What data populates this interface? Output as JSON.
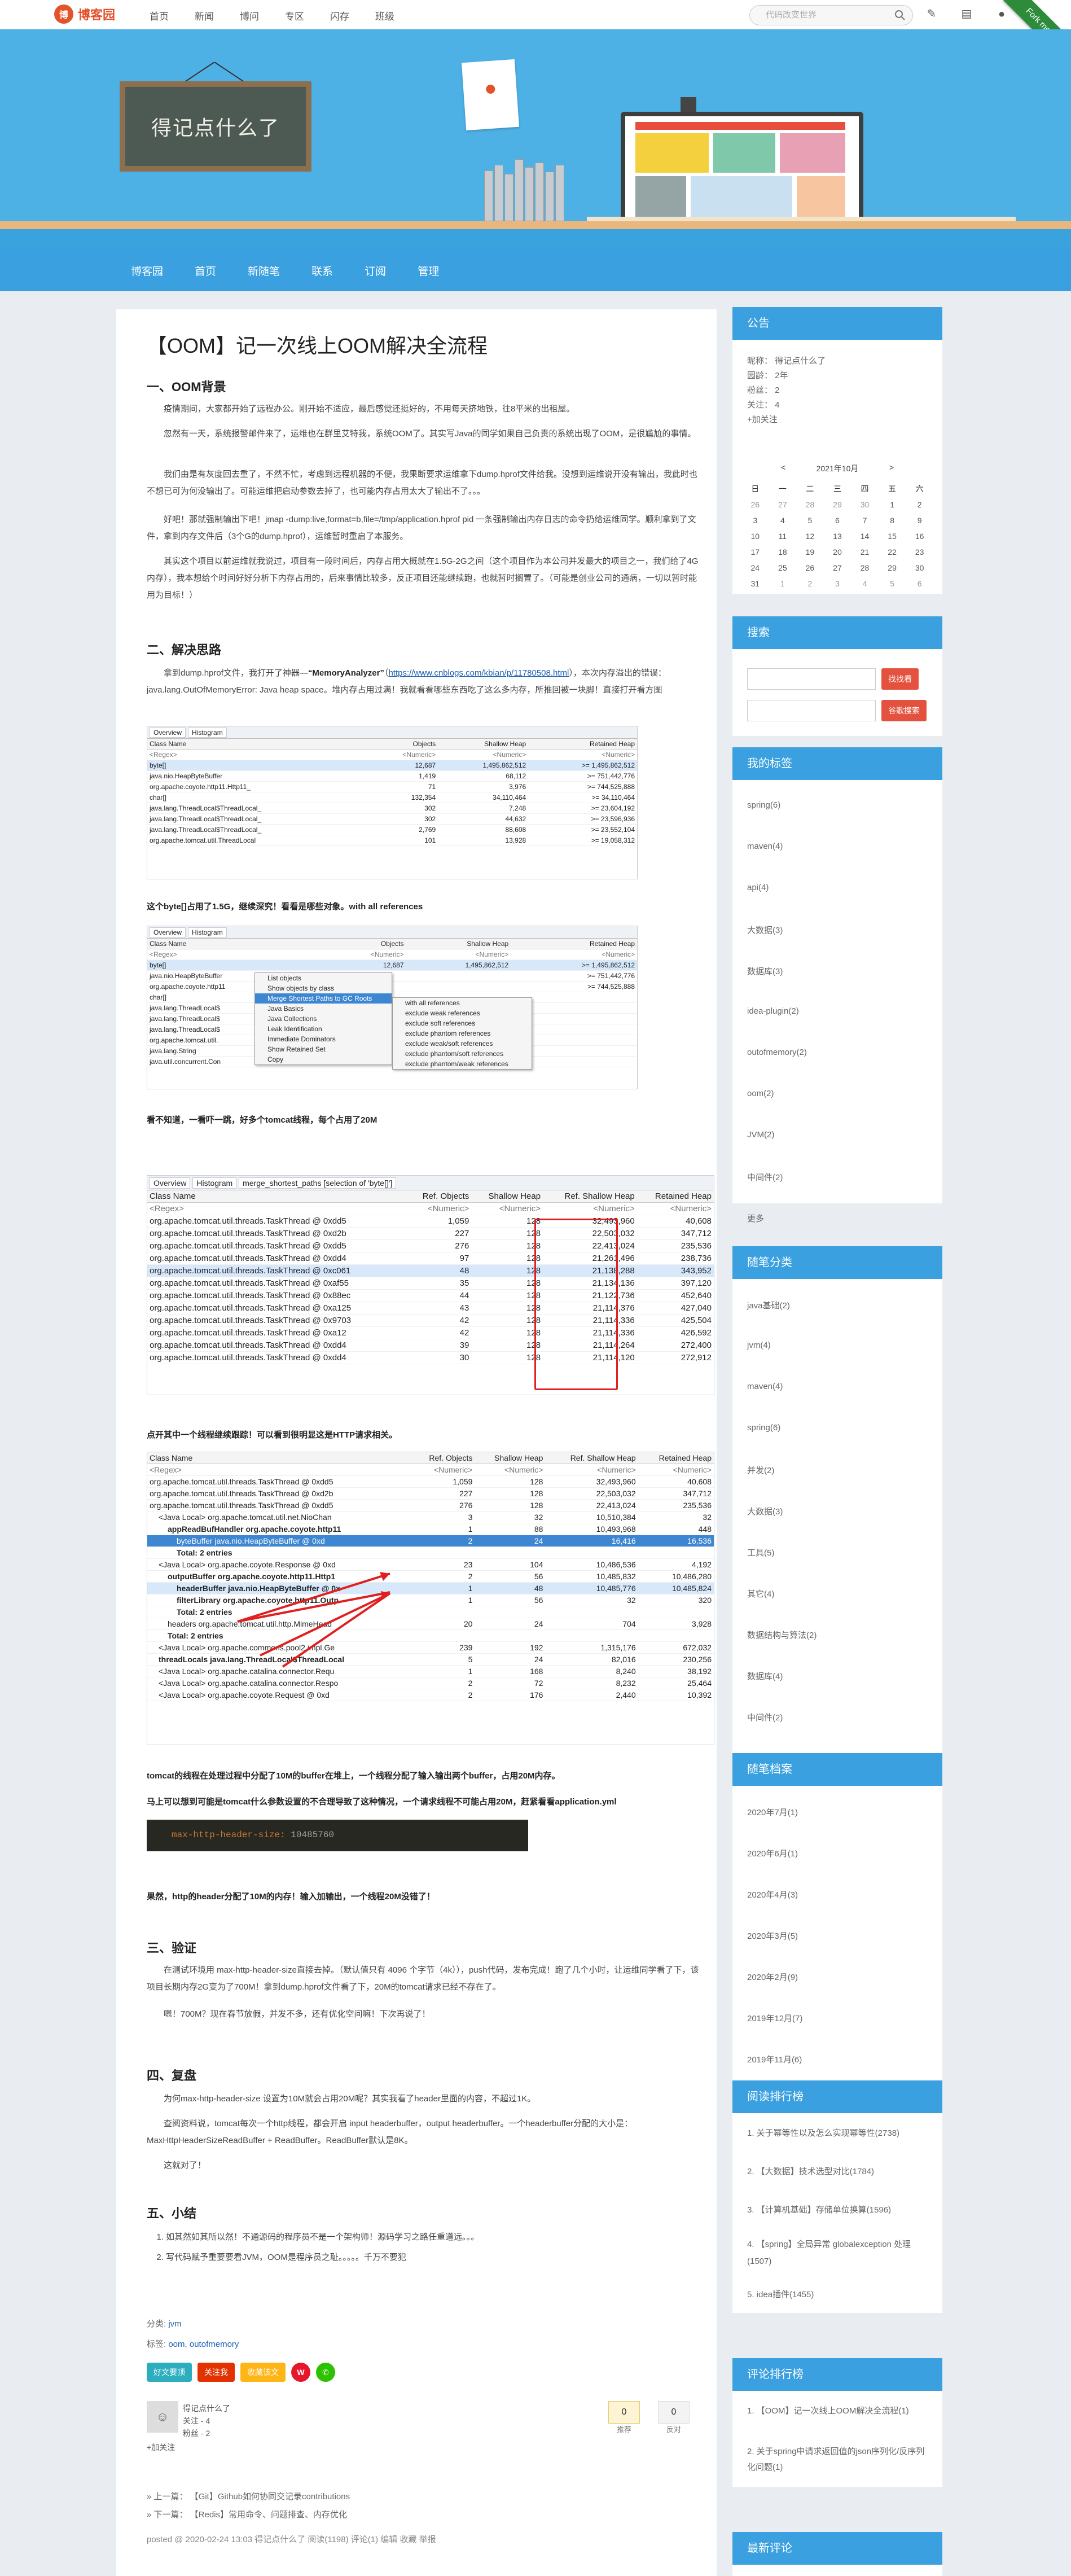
{
  "site": {
    "logo_mark": "博",
    "logo_name": "博客园",
    "nav": [
      "首页",
      "新闻",
      "博问",
      "专区",
      "闪存",
      "班级"
    ],
    "search_placeholder": "代码改变世界",
    "ribbon": "Fork me on GitHub"
  },
  "header": {
    "blog_title": "得记点什么了",
    "nav": [
      "博客园",
      "首页",
      "新随笔",
      "联系",
      "订阅",
      "管理"
    ]
  },
  "article": {
    "title": "【OOM】记一次线上OOM解决全流程",
    "sections": {
      "s1": "一、OOM背景",
      "s2": "二、解决思路",
      "s3": "三、验证",
      "s4": "四、复盘",
      "s5": "五、小结"
    },
    "p1": "疫情期间，大家都开始了远程办公。刚开始不适应，最后感觉还挺好的，不用每天挤地铁，往8平米的出租屋。",
    "p2": "忽然有一天，系统报警邮件来了，运维也在群里艾特我，系统OOM了。其实写Java的同学如果自己负责的系统出现了OOM，是很尴尬的事情。",
    "p3": "我们由是有灰度回去重了，不然不忙，考虑到远程机器的不便，我果断要求运维拿下dump.hprof文件给我。没想到运维说开没有输出，我此时也不想已可为何没输出了。可能运维把启动参数去掉了，也可能内存占用太大了输出不了。。。",
    "p4": "好吧！那就强制输出下吧！jmap -dump:live,format=b,file=/tmp/application.hprof pid   一条强制输出内存日志的命令扔给运维同学。顺利拿到了文件，拿到内存文件后（3个G的dump.hprof），运维暂时重启了本服务。",
    "p5": "其实这个项目以前运维就我说过，项目有一段时间后，内存占用大概就在1.5G-2G之间（这个项目作为本公司并发最大的项目之一，我们给了4G内存），我本想给个时间好好分析下内存占用的，后来事情比较多，反正项目还能继续跑，也就暂时搁置了。（可能是创业公司的通病，一切以暂时能用为目标！）",
    "p6_pre": "拿到dump.hprof文件，我打开了神器—",
    "p6_tool": "“MemoryAnalyzer”",
    "p6_link": "https://www.cnblogs.com/kbian/p/11780508.html",
    "p6_post": "，本次内存溢出的错误：java.lang.OutOfMemoryError: Java heap space。堆内存占用过满！我就看看哪些东西吃了这么多内存，所推回被一块脚！直接打开看方图",
    "caption1": "这个byte[]占用了1.5G，继续深究！看看是哪些对象。with all references",
    "caption2": "看不知道，一看吓一跳，好多个tomcat线程，每个占用了20M",
    "caption3": "点开其中一个线程继续跟踪！可以看到很明显这是HTTP请求相关。",
    "p7": "tomcat的线程在处理过程中分配了10M的buffer在堆上，一个线程分配了输入输出两个buffer，占用20M内存。",
    "p8": "马上可以想到可能是tomcat什么参数设置的不合理导致了这种情况，一个请求线程不可能占用20M，赶紧看看application.yml",
    "code_key": "max-http-header-size:",
    "code_val": "10485760",
    "p9": "果然，http的header分配了10M的内存！输入加输出，一个线程20M没错了！",
    "p10": "在测试环境用 max-http-header-size直接去掉。（默认值只有 4096 个字节（4k）），push代码，发布完成！跑了几个小时，让运维同学看了下，该项目长期内存2G变为了700M！拿到dump.hprof文件看了下，20M的tomcat请求已经不存在了。",
    "p11": "嗯！700M？现在春节放假，并发不多，还有优化空间嘛！下次再说了！",
    "p12": "为何max-http-header-size 设置为10M就会占用20M呢？其实我看了header里面的内容，不超过1K。",
    "p13": "查阅资料说，tomcat每次一个http线程，都会开启 input headerbuffer，output headerbuffer。一个headerbuffer分配的大小是：MaxHttpHeaderSizeReadBuffer + ReadBuffer。ReadBuffer默认是8K。",
    "p14": "这就对了！",
    "sum": [
      "如其然如其所以然！不通源码的程序员不是一个架构师！源码学习之路任重道远。。。",
      "写代码赋予重要要看JVM，OOM是程序员之耻。。。。。千万不要犯"
    ],
    "category_label": "分类:",
    "category": "jvm",
    "tags_label": "标签:",
    "tags": [
      "oom",
      "outofmemory"
    ],
    "share": [
      "好文要顶",
      "关注我",
      "收藏该文"
    ],
    "author_name": "得记点什么了",
    "author_follow": "关注 - 4",
    "author_fans": "粉丝 - 2",
    "follow_btn": "+加关注",
    "up_count": "0",
    "up_label": "推荐",
    "down_count": "0",
    "down_label": "反对",
    "prev": "» 上一篇：  【Git】Github如何协同交记录contributions",
    "next": "» 下一篇：  【Redis】常用命令、问题排查、内存优化",
    "postinfo": "posted @ 2020-02-24 13:03  得记点什么了  阅读(1198)  评论(1)  编辑  收藏  举报"
  },
  "shot1": {
    "tabs": [
      "Overview",
      "Histogram"
    ],
    "headers": [
      "Class Name",
      "Objects",
      "Shallow Heap",
      "Retained Heap"
    ],
    "sub": [
      "<Regex>",
      "<Numeric>",
      "<Numeric>",
      "<Numeric>"
    ],
    "rows": [
      [
        "byte[]",
        "12,687",
        "1,495,862,512",
        ">= 1,495,862,512"
      ],
      [
        "java.nio.HeapByteBuffer",
        "1,419",
        "68,112",
        ">= 751,442,776"
      ],
      [
        "org.apache.coyote.http11.Http11_",
        "71",
        "3,976",
        ">= 744,525,888"
      ],
      [
        "char[]",
        "132,354",
        "34,110,464",
        ">= 34,110,464"
      ],
      [
        "java.lang.ThreadLocal$ThreadLocal_",
        "302",
        "7,248",
        ">= 23,604,192"
      ],
      [
        "java.lang.ThreadLocal$ThreadLocal_",
        "302",
        "44,632",
        ">= 23,596,936"
      ],
      [
        "java.lang.ThreadLocal$ThreadLocal_",
        "2,769",
        "88,608",
        ">= 23,552,104"
      ],
      [
        "org.apache.tomcat.util.ThreadLocal",
        "101",
        "13,928",
        ">= 19,058,312"
      ]
    ]
  },
  "shot2": {
    "tabs": [
      "Overview",
      "Histogram"
    ],
    "headers": [
      "Class Name",
      "Objects",
      "Shallow Heap",
      "Retained Heap"
    ],
    "sub": [
      "<Regex>",
      "<Numeric>",
      "<Numeric>",
      "<Numeric>"
    ],
    "rows": [
      [
        "byte[]",
        "12,687",
        "1,495,862,512",
        ">= 1,495,862,512"
      ],
      [
        "java.nio.HeapByteBuffer",
        "",
        "",
        ">= 751,442,776"
      ],
      [
        "org.apache.coyote.http11",
        "",
        "",
        ">= 744,525,888"
      ],
      [
        "char[]",
        "",
        "",
        ""
      ],
      [
        "java.lang.ThreadLocal$",
        "",
        "",
        ""
      ],
      [
        "java.lang.ThreadLocal$",
        "",
        "",
        ""
      ],
      [
        "java.lang.ThreadLocal$",
        "",
        "",
        ""
      ],
      [
        "org.apache.tomcat.util.",
        "",
        "",
        ""
      ],
      [
        "java.lang.String",
        "",
        "",
        ""
      ],
      [
        "java.util.concurrent.Con",
        "",
        "",
        ""
      ]
    ],
    "menu1": [
      "List objects",
      "Show objects by class",
      "Merge Shortest Paths to GC Roots",
      "Java Basics",
      "Java Collections",
      "Leak Identification",
      "Immediate Dominators",
      "Show Retained Set",
      "Copy"
    ],
    "menu2": [
      "with all references",
      "exclude weak references",
      "exclude soft references",
      "exclude phantom references",
      "exclude weak/soft references",
      "exclude phantom/soft references",
      "exclude phantom/weak references"
    ]
  },
  "shot3": {
    "tabs": [
      "Overview",
      "Histogram",
      "merge_shortest_paths [selection of 'byte[]']"
    ],
    "headers": [
      "Class Name",
      "Ref. Objects",
      "Shallow Heap",
      "Ref. Shallow Heap",
      "Retained Heap"
    ],
    "sub": [
      "<Regex>",
      "<Numeric>",
      "<Numeric>",
      "<Numeric>",
      "<Numeric>"
    ],
    "rows": [
      [
        "org.apache.tomcat.util.threads.TaskThread @ 0xdd5",
        "1,059",
        "128",
        "32,493,960",
        "40,608"
      ],
      [
        "org.apache.tomcat.util.threads.TaskThread @ 0xd2b",
        "227",
        "128",
        "22,503,032",
        "347,712"
      ],
      [
        "org.apache.tomcat.util.threads.TaskThread @ 0xdd5",
        "276",
        "128",
        "22,413,024",
        "235,536"
      ],
      [
        "org.apache.tomcat.util.threads.TaskThread @ 0xdd4",
        "97",
        "128",
        "21,261,496",
        "238,736"
      ],
      [
        "org.apache.tomcat.util.threads.TaskThread @ 0xc061",
        "48",
        "128",
        "21,138,288",
        "343,952"
      ],
      [
        "org.apache.tomcat.util.threads.TaskThread @ 0xaf55",
        "35",
        "128",
        "21,134,136",
        "397,120"
      ],
      [
        "org.apache.tomcat.util.threads.TaskThread @ 0x88ec",
        "44",
        "128",
        "21,122,736",
        "452,640"
      ],
      [
        "org.apache.tomcat.util.threads.TaskThread @ 0xa125",
        "43",
        "128",
        "21,114,376",
        "427,040"
      ],
      [
        "org.apache.tomcat.util.threads.TaskThread @ 0x9703",
        "42",
        "128",
        "21,114,336",
        "425,504"
      ],
      [
        "org.apache.tomcat.util.threads.TaskThread @ 0xa12",
        "42",
        "128",
        "21,114,336",
        "426,592"
      ],
      [
        "org.apache.tomcat.util.threads.TaskThread @ 0xdd4",
        "39",
        "128",
        "21,114,264",
        "272,400"
      ],
      [
        "org.apache.tomcat.util.threads.TaskThread @ 0xdd4",
        "30",
        "128",
        "21,114,120",
        "272,912"
      ]
    ]
  },
  "shot4": {
    "headers": [
      "Class Name",
      "Ref. Objects",
      "Shallow Heap",
      "Ref. Shallow Heap",
      "Retained Heap"
    ],
    "sub": [
      "<Regex>",
      "<Numeric>",
      "<Numeric>",
      "<Numeric>",
      "<Numeric>"
    ],
    "rows": [
      [
        "org.apache.tomcat.util.threads.TaskThread @ 0xdd5",
        "1,059",
        "128",
        "32,493,960",
        "40,608"
      ],
      [
        "org.apache.tomcat.util.threads.TaskThread @ 0xd2b",
        "227",
        "128",
        "22,503,032",
        "347,712"
      ],
      [
        "org.apache.tomcat.util.threads.TaskThread @ 0xdd5",
        "276",
        "128",
        "22,413,024",
        "235,536"
      ],
      [
        "<Java Local> org.apache.tomcat.util.net.NioChan",
        "3",
        "32",
        "10,510,384",
        "32"
      ],
      [
        "appReadBufHandler org.apache.coyote.http11",
        "1",
        "88",
        "10,493,968",
        "448"
      ],
      [
        "byteBuffer java.nio.HeapByteBuffer @ 0xd",
        "2",
        "24",
        "16,416",
        "16,536"
      ],
      [
        "Total: 2 entries",
        "",
        "",
        "",
        ""
      ],
      [
        "<Java Local> org.apache.coyote.Response @ 0xd",
        "23",
        "104",
        "10,486,536",
        "4,192"
      ],
      [
        "outputBuffer org.apache.coyote.http11.Http1",
        "2",
        "56",
        "10,485,832",
        "10,486,280"
      ],
      [
        "headerBuffer java.nio.HeapByteBuffer @ 0x",
        "1",
        "48",
        "10,485,776",
        "10,485,824"
      ],
      [
        "filterLibrary org.apache.coyote.http11.Outp",
        "1",
        "56",
        "32",
        "320"
      ],
      [
        "Total: 2 entries",
        "",
        "",
        "",
        ""
      ],
      [
        "headers org.apache.tomcat.util.http.MimeHead",
        "20",
        "24",
        "704",
        "3,928"
      ],
      [
        "Total: 2 entries",
        "",
        "",
        "",
        ""
      ],
      [
        "<Java Local> org.apache.commons.pool2.impl.Ge",
        "239",
        "192",
        "1,315,176",
        "672,032"
      ],
      [
        "threadLocals java.lang.ThreadLocal$ThreadLocal",
        "5",
        "24",
        "82,016",
        "230,256"
      ],
      [
        "<Java Local> org.apache.catalina.connector.Requ",
        "1",
        "168",
        "8,240",
        "38,192"
      ],
      [
        "<Java Local> org.apache.catalina.connector.Respo",
        "2",
        "72",
        "8,232",
        "25,464"
      ],
      [
        "<Java Local> org.apache.coyote.Request @ 0xd",
        "2",
        "176",
        "2,440",
        "10,392"
      ]
    ]
  },
  "sidebar": {
    "notice_title": "公告",
    "notice": [
      "昵称：  得记点什么了",
      "园龄：  2年",
      "粉丝：  2",
      "关注：  4"
    ],
    "notice_follow": "+加关注",
    "cal_caption": "2021年10月",
    "cal_prev": "<",
    "cal_next": ">",
    "cal_week": [
      "日",
      "一",
      "二",
      "三",
      "四",
      "五",
      "六"
    ],
    "cal_rows": [
      [
        "26",
        "27",
        "28",
        "29",
        "30",
        "1",
        "2"
      ],
      [
        "3",
        "4",
        "5",
        "6",
        "7",
        "8",
        "9"
      ],
      [
        "10",
        "11",
        "12",
        "13",
        "14",
        "15",
        "16"
      ],
      [
        "17",
        "18",
        "19",
        "20",
        "21",
        "22",
        "23"
      ],
      [
        "24",
        "25",
        "26",
        "27",
        "28",
        "29",
        "30"
      ],
      [
        "31",
        "1",
        "2",
        "3",
        "4",
        "5",
        "6"
      ]
    ],
    "search_title": "搜索",
    "search_btn1": "找找看",
    "search_btn2": "谷歌搜索",
    "tags_title": "我的标签",
    "tags": [
      "spring(6)",
      "maven(4)",
      "api(4)",
      "大数据(3)",
      "数据库(3)",
      "idea-plugin(2)",
      "outofmemory(2)",
      "oom(2)",
      "JVM(2)",
      "中间件(2)",
      "更多"
    ],
    "cats_title": "随笔分类",
    "cats": [
      "java基础(2)",
      "jvm(4)",
      "maven(4)",
      "spring(6)",
      "并发(2)",
      "大数据(3)",
      "工具(5)",
      "其它(4)",
      "数据结构与算法(2)",
      "数据库(4)",
      "中间件(2)"
    ],
    "archive_title": "随笔档案",
    "archive": [
      "2020年7月(1)",
      "2020年6月(1)",
      "2020年4月(3)",
      "2020年3月(5)",
      "2020年2月(9)",
      "2019年12月(7)",
      "2019年11月(6)"
    ],
    "read_title": "阅读排行榜",
    "read": [
      "1. 关于幂等性以及怎么实现幂等性(2738)",
      "2. 【大数据】技术选型对比(1784)",
      "3. 【计算机基础】存储单位换算(1596)",
      "4. 【spring】全局异常 globalexception 处理(1507)",
      "5. idea插件(1455)"
    ],
    "comment_title": "评论排行榜",
    "comment": [
      "1. 【OOM】记一次线上OOM解决全流程(1)",
      "2. 关于spring中请求返回值的json序列化/反序列化问题(1)"
    ],
    "latest_title": "最新评论"
  },
  "colors": {
    "accent": "#3aa0df",
    "logo": "#e2522b",
    "red": "#e02020"
  }
}
